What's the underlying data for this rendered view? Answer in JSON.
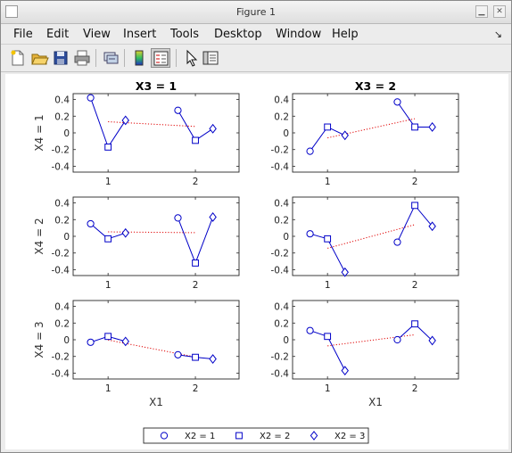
{
  "window": {
    "title": "Figure 1"
  },
  "menu": {
    "file": "File",
    "edit": "Edit",
    "view": "View",
    "insert": "Insert",
    "tools": "Tools",
    "desktop": "Desktop",
    "window": "Window",
    "help": "Help"
  },
  "toolbar": {
    "icons": [
      "new-figure-icon",
      "open-file-icon",
      "save-icon",
      "print-icon",
      "link-icon",
      "colorbar-icon",
      "legend-icon",
      "pointer-icon",
      "property-editor-icon"
    ]
  },
  "colors": {
    "data_line": "#0000c8",
    "mean_line": "#e00000"
  },
  "chart_data": {
    "type": "line",
    "grid": false,
    "legend_position": "bottom",
    "column_titles": [
      "X3 = 1",
      "X3 = 2"
    ],
    "row_labels": [
      "X4 = 1",
      "X4 = 2",
      "X4 = 3"
    ],
    "xlabel": "X1",
    "xticks": [
      1,
      2
    ],
    "yticks": [
      "0.4",
      "0.2",
      "0",
      "-0.2",
      "-0.4"
    ],
    "xlim": [
      0.6,
      2.5
    ],
    "ylim": [
      -0.47,
      0.47
    ],
    "legend": [
      {
        "label": "X2 = 1",
        "marker": "circle"
      },
      {
        "label": "X2 = 2",
        "marker": "square"
      },
      {
        "label": "X2 = 3",
        "marker": "diamond"
      }
    ],
    "panels": [
      {
        "row": 0,
        "col": 0,
        "x1_groups": [
          {
            "x1": 1,
            "points": [
              {
                "x": 0.8,
                "y": 0.42,
                "x2": 1
              },
              {
                "x": 1.0,
                "y": -0.17,
                "x2": 2
              },
              {
                "x": 1.2,
                "y": 0.15,
                "x2": 3
              }
            ]
          },
          {
            "x1": 2,
            "points": [
              {
                "x": 1.8,
                "y": 0.27,
                "x2": 1
              },
              {
                "x": 2.0,
                "y": -0.09,
                "x2": 2
              },
              {
                "x": 2.2,
                "y": 0.05,
                "x2": 3
              }
            ]
          }
        ]
      },
      {
        "row": 0,
        "col": 1,
        "x1_groups": [
          {
            "x1": 1,
            "points": [
              {
                "x": 0.8,
                "y": -0.22,
                "x2": 1
              },
              {
                "x": 1.0,
                "y": 0.07,
                "x2": 2
              },
              {
                "x": 1.2,
                "y": -0.03,
                "x2": 3
              }
            ]
          },
          {
            "x1": 2,
            "points": [
              {
                "x": 1.8,
                "y": 0.37,
                "x2": 1
              },
              {
                "x": 2.0,
                "y": 0.07,
                "x2": 2
              },
              {
                "x": 2.2,
                "y": 0.07,
                "x2": 3
              }
            ]
          }
        ]
      },
      {
        "row": 1,
        "col": 0,
        "x1_groups": [
          {
            "x1": 1,
            "points": [
              {
                "x": 0.8,
                "y": 0.15,
                "x2": 1
              },
              {
                "x": 1.0,
                "y": -0.03,
                "x2": 2
              },
              {
                "x": 1.2,
                "y": 0.04,
                "x2": 3
              }
            ]
          },
          {
            "x1": 2,
            "points": [
              {
                "x": 1.8,
                "y": 0.22,
                "x2": 1
              },
              {
                "x": 2.0,
                "y": -0.32,
                "x2": 2
              },
              {
                "x": 2.2,
                "y": 0.23,
                "x2": 3
              }
            ]
          }
        ]
      },
      {
        "row": 1,
        "col": 1,
        "x1_groups": [
          {
            "x1": 1,
            "points": [
              {
                "x": 0.8,
                "y": 0.03,
                "x2": 1
              },
              {
                "x": 1.0,
                "y": -0.03,
                "x2": 2
              },
              {
                "x": 1.2,
                "y": -0.43,
                "x2": 3
              }
            ]
          },
          {
            "x1": 2,
            "points": [
              {
                "x": 1.8,
                "y": -0.07,
                "x2": 1
              },
              {
                "x": 2.0,
                "y": 0.37,
                "x2": 2
              },
              {
                "x": 2.2,
                "y": 0.12,
                "x2": 3
              }
            ]
          }
        ]
      },
      {
        "row": 2,
        "col": 0,
        "x1_groups": [
          {
            "x1": 1,
            "points": [
              {
                "x": 0.8,
                "y": -0.03,
                "x2": 1
              },
              {
                "x": 1.0,
                "y": 0.04,
                "x2": 2
              },
              {
                "x": 1.2,
                "y": -0.02,
                "x2": 3
              }
            ]
          },
          {
            "x1": 2,
            "points": [
              {
                "x": 1.8,
                "y": -0.18,
                "x2": 1
              },
              {
                "x": 2.0,
                "y": -0.21,
                "x2": 2
              },
              {
                "x": 2.2,
                "y": -0.23,
                "x2": 3
              }
            ]
          }
        ]
      },
      {
        "row": 2,
        "col": 1,
        "x1_groups": [
          {
            "x1": 1,
            "points": [
              {
                "x": 0.8,
                "y": 0.11,
                "x2": 1
              },
              {
                "x": 1.0,
                "y": 0.04,
                "x2": 2
              },
              {
                "x": 1.2,
                "y": -0.37,
                "x2": 3
              }
            ]
          },
          {
            "x1": 2,
            "points": [
              {
                "x": 1.8,
                "y": 0.0,
                "x2": 1
              },
              {
                "x": 2.0,
                "y": 0.19,
                "x2": 2
              },
              {
                "x": 2.2,
                "y": -0.01,
                "x2": 3
              }
            ]
          }
        ]
      }
    ]
  }
}
